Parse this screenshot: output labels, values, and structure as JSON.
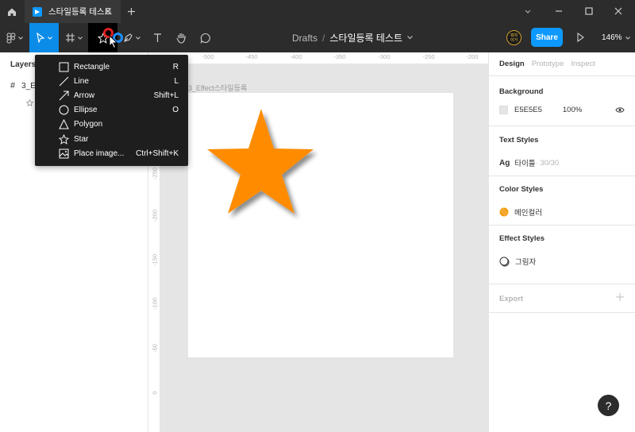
{
  "titlebar": {
    "tab_title": "스타일등록 테스트"
  },
  "toolbar": {
    "breadcrumb_root": "Drafts",
    "breadcrumb_sep": "/",
    "file_name": "스타일등록 테스트",
    "share_label": "Share",
    "zoom_label": "146%",
    "avatar_text_line1": "뭐야",
    "avatar_text_line2": "이거"
  },
  "shape_menu": {
    "items": [
      {
        "label": "Rectangle",
        "shortcut": "R",
        "icon": "rectangle-icon"
      },
      {
        "label": "Line",
        "shortcut": "L",
        "icon": "line-icon"
      },
      {
        "label": "Arrow",
        "shortcut": "Shift+L",
        "icon": "arrow-icon"
      },
      {
        "label": "Ellipse",
        "shortcut": "O",
        "icon": "ellipse-icon"
      },
      {
        "label": "Polygon",
        "shortcut": "",
        "icon": "polygon-icon"
      },
      {
        "label": "Star",
        "shortcut": "",
        "icon": "star-icon"
      },
      {
        "label": "Place image...",
        "shortcut": "Ctrl+Shift+K",
        "icon": "image-icon"
      }
    ]
  },
  "layers": {
    "title": "Layers",
    "frame_layer": "3_E"
  },
  "canvas": {
    "frame_label": "3_Effect스타일등록",
    "star_color": "#FF8C00",
    "ruler_top": [
      "-500",
      "-450",
      "-400",
      "-350",
      "-300",
      "-250",
      "-200"
    ],
    "ruler_left": [
      "-250",
      "-200",
      "-150",
      "-100",
      "-50",
      "0"
    ]
  },
  "right_panel": {
    "tabs": [
      "Design",
      "Prototype",
      "Inspect"
    ],
    "background": {
      "title": "Background",
      "hex": "E5E5E5",
      "opacity": "100%"
    },
    "text_styles": {
      "title": "Text Styles",
      "name": "타이틀",
      "detail": " · 30/30"
    },
    "color_styles": {
      "title": "Color Styles",
      "name": "메인컬러",
      "color": "#F39C12"
    },
    "effect_styles": {
      "title": "Effect Styles",
      "name": "그림자"
    },
    "export_title": "Export"
  },
  "help_label": "?"
}
